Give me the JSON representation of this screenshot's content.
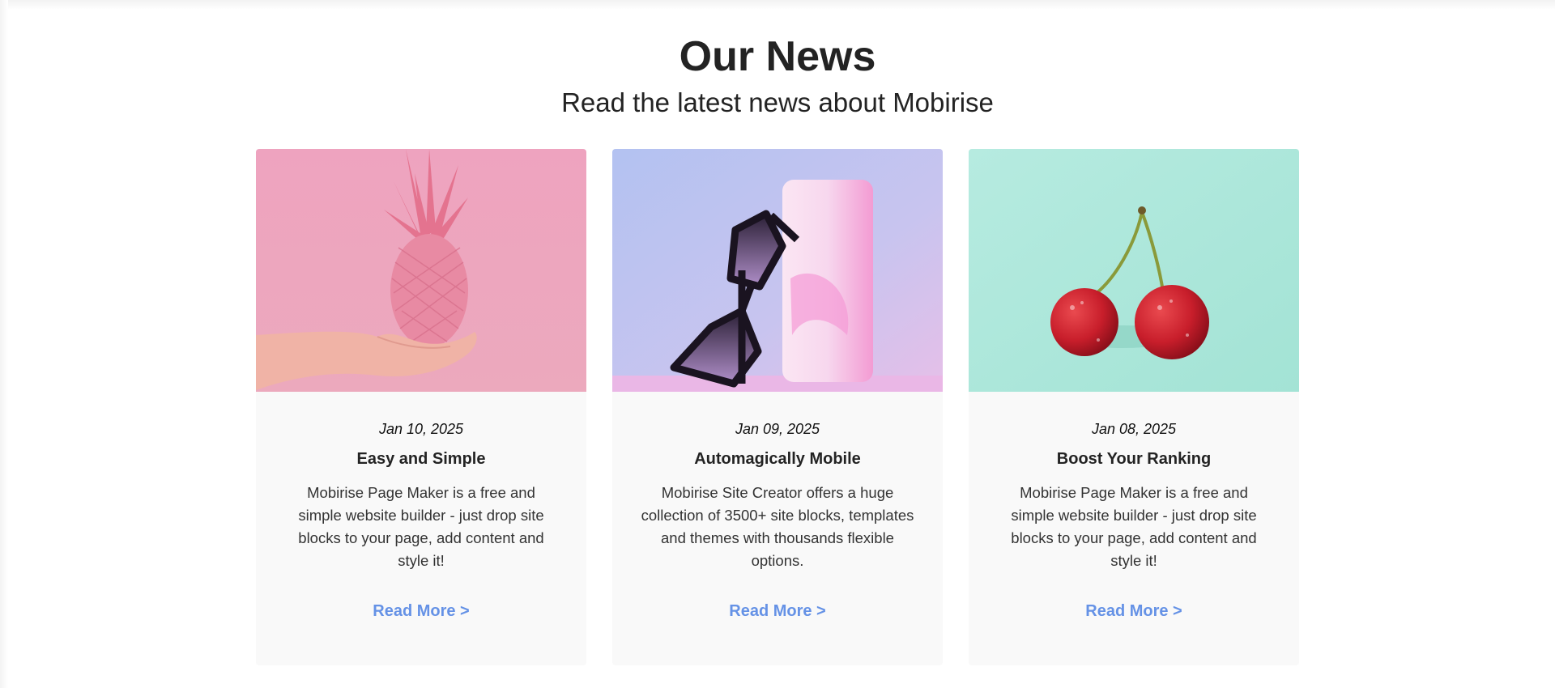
{
  "section": {
    "title": "Our News",
    "subtitle": "Read the latest news about Mobirise"
  },
  "cards": [
    {
      "date": "Jan 10, 2025",
      "title": "Easy and Simple",
      "text": "Mobirise Page Maker is a free and simple website builder - just drop site blocks to your page, add content and style it!",
      "link": "Read More >",
      "image": "pink-pineapple-in-hand"
    },
    {
      "date": "Jan 09, 2025",
      "title": "Automagically Mobile",
      "text": "Mobirise Site Creator offers a huge collection of 3500+ site blocks, templates and themes with thousands flexible options.",
      "link": "Read More >",
      "image": "sunglasses-and-phone"
    },
    {
      "date": "Jan 08, 2025",
      "title": "Boost Your Ranking",
      "text": "Mobirise Page Maker is a free and simple website builder - just drop site blocks to your page, add content and style it!",
      "link": "Read More >",
      "image": "red-cherries"
    }
  ],
  "colors": {
    "link": "#6592e6",
    "card_background": "#f9f9f9",
    "heading": "#232323"
  }
}
